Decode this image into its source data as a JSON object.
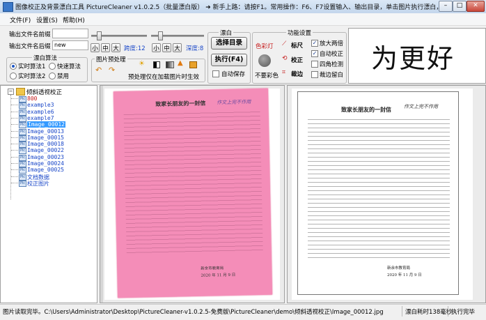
{
  "window": {
    "title": "图像校正及背景漂白工具 PictureCleaner v1.0.2.5（批量漂白版） ➜ 新手上路：请按F1。常用操作：F6、F7设置输入、输出目录，单击图片执行漂白，目录名回车批量漂…",
    "btn_min": "–",
    "btn_max": "□",
    "btn_close": "✕"
  },
  "menu": [
    "文件(F)",
    "设置(S)",
    "帮助(H)"
  ],
  "output": {
    "prefix_label": "输出文件名前缀",
    "prefix_value": "",
    "suffix_label": "输出文件名后缀",
    "suffix_value": "new"
  },
  "bleach_algo": {
    "title": "漂白算法",
    "options": [
      "实时算法1",
      "快速算法",
      "实时算法2",
      "禁用"
    ],
    "selected": "实时算法1"
  },
  "sliders": {
    "small": "小",
    "medium": "中",
    "large": "大",
    "span_label": "跨度:12",
    "depth_label": "深度:8"
  },
  "preprocess": {
    "title": "图片预处理",
    "note": "预处理仅在加载图片时生效"
  },
  "bleach": {
    "title": "漂白",
    "select_dir": "选择目录",
    "execute": "执行(F4)",
    "autosave": "自动保存"
  },
  "features": {
    "title": "功能设置",
    "color_light": "色彩灯",
    "ruler": "标尺",
    "correct": "校正",
    "crop": "裁边",
    "no_color": "不要彩色",
    "checks": [
      {
        "label": "放大两倍",
        "checked": true
      },
      {
        "label": "自动校正",
        "checked": true
      },
      {
        "label": "四角检测",
        "checked": false
      },
      {
        "label": "裁边留白",
        "checked": false
      }
    ]
  },
  "signature": "为更好",
  "tree": {
    "root": "倾斜透视校正",
    "items": [
      {
        "label": "800",
        "type": "file",
        "color": "red"
      },
      {
        "label": "example3",
        "type": "file",
        "color": "blue"
      },
      {
        "label": "example6",
        "type": "file",
        "color": "blue"
      },
      {
        "label": "example7",
        "type": "file",
        "color": "blue"
      },
      {
        "label": "Image_00012",
        "type": "file",
        "color": "blue",
        "selected": true
      },
      {
        "label": "Image_00013",
        "type": "file",
        "color": "blue"
      },
      {
        "label": "Image_00015",
        "type": "file",
        "color": "blue"
      },
      {
        "label": "Image_00018",
        "type": "file",
        "color": "blue"
      },
      {
        "label": "Image_00022",
        "type": "file",
        "color": "blue"
      },
      {
        "label": "Image_00023",
        "type": "file",
        "color": "blue"
      },
      {
        "label": "Image_00024",
        "type": "file",
        "color": "blue"
      },
      {
        "label": "Image_00025",
        "type": "file",
        "color": "blue"
      },
      {
        "label": "文档数据",
        "type": "file",
        "color": "blue"
      },
      {
        "label": "校正图片",
        "type": "file",
        "color": "blue"
      }
    ]
  },
  "document": {
    "title": "致家长朋友的一封信",
    "handwriting": "作文上完不作用",
    "signoff_1": "新余市教育局",
    "signoff_2": "2020 年 11 月 9 日"
  },
  "status": {
    "path": "图片读取完毕。C:\\Users\\Administrator\\Desktop\\PictureCleaner-v1.0.2.5-免费版\\PictureCleaner\\demo\\倾斜透视校正\\Image_00012.jpg",
    "time": "漂白耗时138毫秒",
    "done": "执行完毕"
  },
  "colors": {
    "pink_page": "#f48db8",
    "selected_bg": "#3399ff",
    "accent_blue": "#1846c8"
  }
}
